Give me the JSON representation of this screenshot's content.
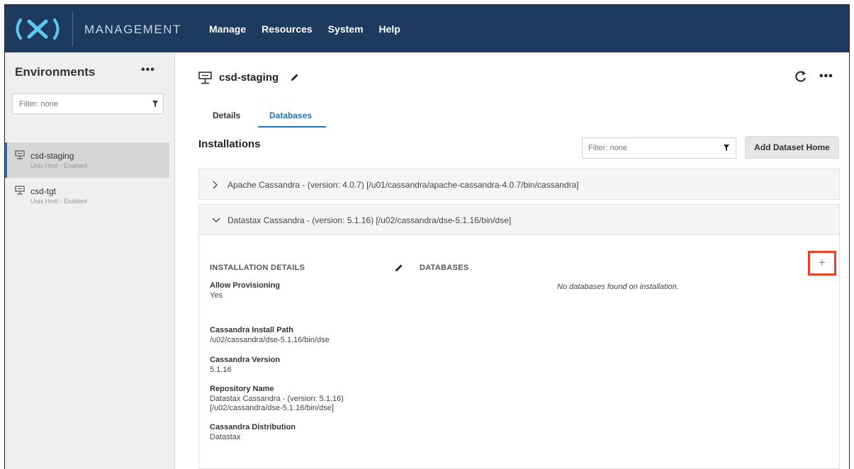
{
  "app": {
    "brand": "MANAGEMENT",
    "logo_text": "(X)",
    "nav": [
      "Manage",
      "Resources",
      "System",
      "Help"
    ]
  },
  "sidebar": {
    "title": "Environments",
    "more": "•••",
    "filter_placeholder": "Filter: none",
    "items": [
      {
        "name": "csd-staging",
        "sub": "Unix Host - Enabled",
        "active": true
      },
      {
        "name": "csd-tgt",
        "sub": "Unix Host - Enabled",
        "active": false
      }
    ]
  },
  "main": {
    "host_title": "csd-staging",
    "more": "•••",
    "tabs": [
      {
        "label": "Details",
        "active": false
      },
      {
        "label": "Databases",
        "active": true
      }
    ],
    "installations_title": "Installations",
    "filter_placeholder": "Filter: none",
    "add_button": "Add Dataset Home",
    "installations": [
      {
        "label": "Apache Cassandra - (version: 4.0.7) [/u01/cassandra/apache-cassandra-4.0.7/bin/cassandra]",
        "expanded": false
      },
      {
        "label": "Datastax Cassandra - (version: 5.1.16) [/u02/cassandra/dse-5.1.16/bin/dse]",
        "expanded": true
      }
    ],
    "details_heading": "INSTALLATION DETAILS",
    "databases_heading": "DATABASES",
    "add_db_symbol": "+",
    "no_databases": "No databases found on installation.",
    "fields": [
      {
        "label": "Allow Provisioning",
        "value": "Yes"
      },
      {
        "label": "Cassandra Install Path",
        "value": "/u02/cassandra/dse-5.1.16/bin/dse"
      },
      {
        "label": "Cassandra Version",
        "value": "5.1.16"
      },
      {
        "label": "Repository Name",
        "value": "Datastax Cassandra - (version: 5.1.16)",
        "value2": "[/u02/cassandra/dse-5.1.16/bin/dse]"
      },
      {
        "label": "Cassandra Distribution",
        "value": "Datastax"
      }
    ]
  },
  "colors": {
    "topbar": "#1f3a5f",
    "accent": "#1a73c8",
    "highlight": "#e8432a"
  }
}
